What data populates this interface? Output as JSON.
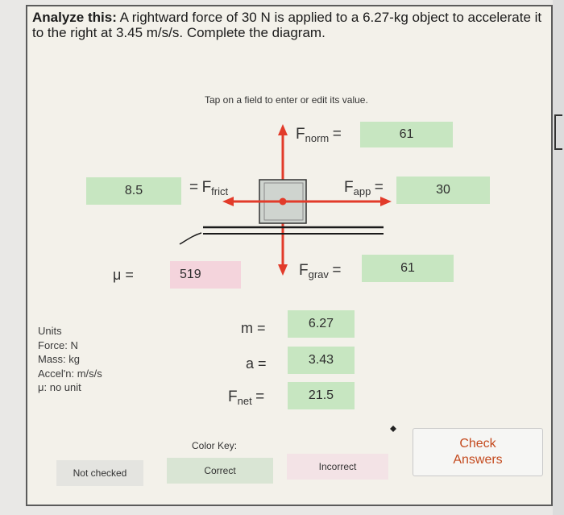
{
  "problem": {
    "lead": "Analyze this:",
    "text": " A rightward force of 30 N is applied to a 6.27-kg object to accelerate it to the right at 3.45 m/s/s. Complete the diagram."
  },
  "instruction": "Tap on a field to enter or edit its value.",
  "forces": {
    "norm": {
      "symbol": "F",
      "sub": "norm",
      "eq": "=",
      "value": "61"
    },
    "frict": {
      "eq": "=",
      "symbol": "F",
      "sub": "frict",
      "value": "8.5"
    },
    "app": {
      "symbol": "F",
      "sub": "app",
      "eq": "=",
      "value": "30"
    },
    "grav": {
      "symbol": "F",
      "sub": "grav",
      "eq": "=",
      "value": "61"
    }
  },
  "mu": {
    "label": "μ =",
    "value": "519"
  },
  "quantities": {
    "m": {
      "label": "m =",
      "value": "6.27"
    },
    "a": {
      "label": "a =",
      "value": "3.43"
    },
    "fnet": {
      "symbol": "F",
      "sub": "net",
      "eq": "=",
      "value": "21.5"
    }
  },
  "units": {
    "title": "Units",
    "force": "Force: N",
    "mass": "Mass: kg",
    "accel": "Accel'n: m/s/s",
    "mu": "μ: no unit"
  },
  "color_key": {
    "label": "Color Key:",
    "not_checked": "Not checked",
    "correct": "Correct",
    "incorrect": "Incorrect",
    "colors": {
      "not_checked": "#e4e4e0",
      "correct": "#d9e5d4",
      "incorrect": "#f3e3e6"
    }
  },
  "check_button": {
    "line1": "Check",
    "line2": "Answers"
  },
  "colors": {
    "field_green": "#c7e6c1",
    "field_pink": "#f4d4dc",
    "arrow_red": "#e23b2a",
    "check_text": "#c44a1e"
  }
}
